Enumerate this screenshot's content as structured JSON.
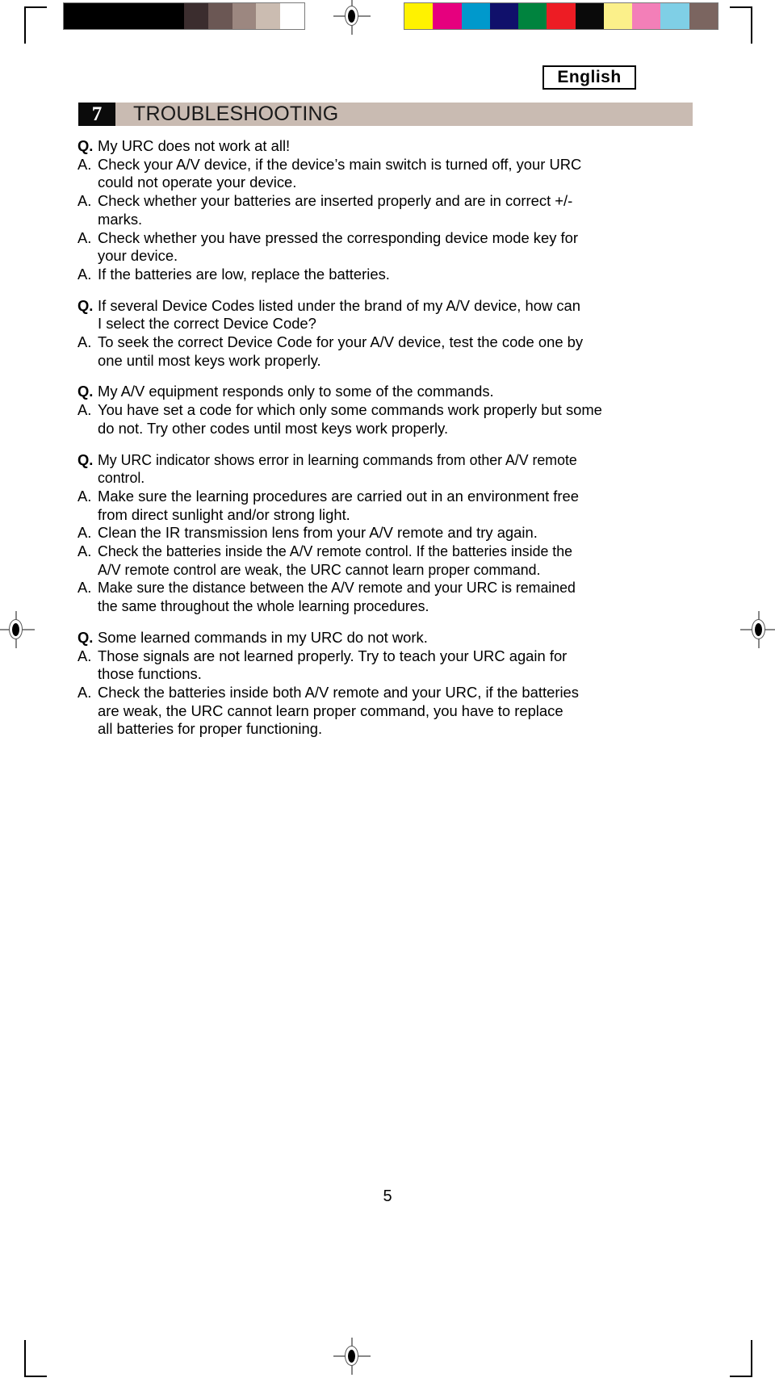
{
  "print_marks": {
    "colorbar_left": {
      "name": "grayscale-density-strip",
      "swatches": [
        {
          "color": "#000000",
          "flex": 10
        },
        {
          "color": "#3b2d2e",
          "flex": 2
        },
        {
          "color": "#6b5754",
          "flex": 2
        },
        {
          "color": "#9c8780",
          "flex": 2
        },
        {
          "color": "#cbbcb1",
          "flex": 2
        },
        {
          "color": "#ffffff",
          "flex": 2
        }
      ]
    },
    "colorbar_right": {
      "name": "process-color-strip",
      "swatches": [
        {
          "color": "#fff200",
          "flex": 1
        },
        {
          "color": "#e6007e",
          "flex": 1
        },
        {
          "color": "#0099cc",
          "flex": 1
        },
        {
          "color": "#10106b",
          "flex": 1
        },
        {
          "color": "#00833e",
          "flex": 1
        },
        {
          "color": "#ed1c24",
          "flex": 1
        },
        {
          "color": "#0a0a0a",
          "flex": 1
        },
        {
          "color": "#fbf08a",
          "flex": 1
        },
        {
          "color": "#f37fb8",
          "flex": 1
        },
        {
          "color": "#7fcfe6",
          "flex": 1
        },
        {
          "color": "#7b6560",
          "flex": 1
        }
      ]
    },
    "registration_mark_label": "registration-target"
  },
  "header": {
    "language": "English"
  },
  "section": {
    "number": "7",
    "title": "TROUBLESHOOTING",
    "number_box_color": "#0b0b0b",
    "title_bar_color": "#c9bbb2"
  },
  "faq": {
    "groups": [
      {
        "lines": [
          {
            "marker": "Q.",
            "type": "q",
            "paragraphs": [
              "My URC does not work at all!"
            ]
          },
          {
            "marker": "A.",
            "type": "a",
            "paragraphs": [
              "Check your A/V device, if the device’s main switch is turned off, your URC",
              "could not operate your device."
            ]
          },
          {
            "marker": "A.",
            "type": "a",
            "paragraphs": [
              "Check whether your batteries are inserted properly and are in correct +/-",
              "marks."
            ]
          },
          {
            "marker": "A.",
            "type": "a",
            "paragraphs": [
              "Check whether you have pressed the corresponding device mode key for",
              "your device."
            ]
          },
          {
            "marker": "A.",
            "type": "a",
            "paragraphs": [
              "If the batteries are low, replace the batteries."
            ]
          }
        ]
      },
      {
        "lines": [
          {
            "marker": "Q.",
            "type": "q",
            "paragraphs": [
              "If several Device Codes listed under the brand of my A/V device, how can",
              "I select the correct Device Code?"
            ]
          },
          {
            "marker": "A.",
            "type": "a",
            "paragraphs": [
              "To seek the correct Device Code for your A/V device, test the code one by",
              "one until most keys work properly."
            ]
          }
        ]
      },
      {
        "lines": [
          {
            "marker": "Q.",
            "type": "q",
            "paragraphs": [
              "My A/V equipment responds only to some of the commands."
            ]
          },
          {
            "marker": "A.",
            "type": "a",
            "paragraphs": [
              "You have set a code for which only some commands work properly but some",
              "do not. Try other codes until most keys work properly."
            ]
          }
        ]
      },
      {
        "lines": [
          {
            "marker": "Q.",
            "type": "q",
            "condensed": true,
            "paragraphs": [
              "My URC indicator shows error in learning commands from other A/V remote",
              "control."
            ]
          },
          {
            "marker": "A.",
            "type": "a",
            "paragraphs": [
              "Make sure the learning procedures are carried out in an environment free",
              "from direct sunlight and/or strong light."
            ]
          },
          {
            "marker": "A.",
            "type": "a",
            "paragraphs": [
              "Clean the IR transmission lens from your A/V remote and try again."
            ]
          },
          {
            "marker": "A.",
            "type": "a",
            "condensed": true,
            "paragraphs": [
              "Check the batteries inside the A/V remote control. If the batteries inside the",
              "A/V remote control are weak, the URC cannot learn proper command."
            ]
          },
          {
            "marker": "A.",
            "type": "a",
            "condensed": true,
            "paragraphs": [
              "Make sure the distance between the A/V remote and your URC is remained",
              "the same throughout the whole learning procedures."
            ]
          }
        ]
      },
      {
        "lines": [
          {
            "marker": "Q.",
            "type": "q",
            "paragraphs": [
              "Some learned commands in my URC do not work."
            ]
          },
          {
            "marker": "A.",
            "type": "a",
            "paragraphs": [
              "Those signals are not learned properly. Try to teach your URC again for",
              "those functions."
            ]
          },
          {
            "marker": "A.",
            "type": "a",
            "paragraphs": [
              "Check the batteries inside both A/V remote and your URC, if the batteries",
              "are weak, the URC cannot learn proper command, you have to replace",
              "all batteries for proper functioning."
            ]
          }
        ]
      }
    ]
  },
  "footer": {
    "page_number": "5"
  }
}
